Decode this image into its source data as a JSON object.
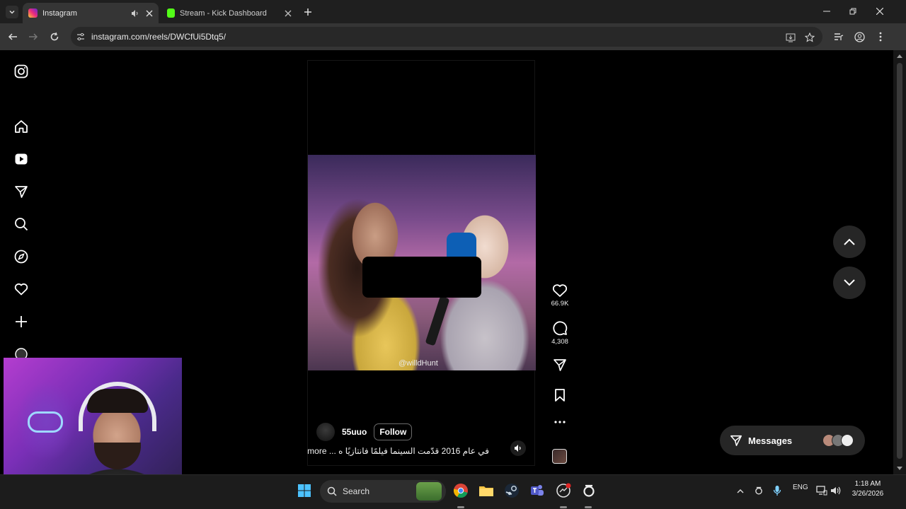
{
  "browser": {
    "tabs": [
      {
        "title": "Instagram",
        "active": true
      },
      {
        "title": "Stream - Kick Dashboard",
        "active": false
      }
    ],
    "url": "instagram.com/reels/DWCfUi5Dtq5/"
  },
  "reel": {
    "watermark": "@willdHunt",
    "username": "55uuo",
    "follow_label": "Follow",
    "caption": "في عام 2016 قدّمت السينما فيلمًا فانتازيًا ه ... more",
    "likes": "66.9K",
    "comments": "4,308"
  },
  "messages": {
    "label": "Messages"
  },
  "taskbar": {
    "search_label": "Search",
    "language": "ENG",
    "time": "1:18 AM",
    "date": "3/26/2026"
  },
  "colors": {
    "instagram_tab_icon": "#e1306c",
    "kick_green": "#53fc18",
    "page_bg": "#000000",
    "button_bg": "#262626"
  }
}
